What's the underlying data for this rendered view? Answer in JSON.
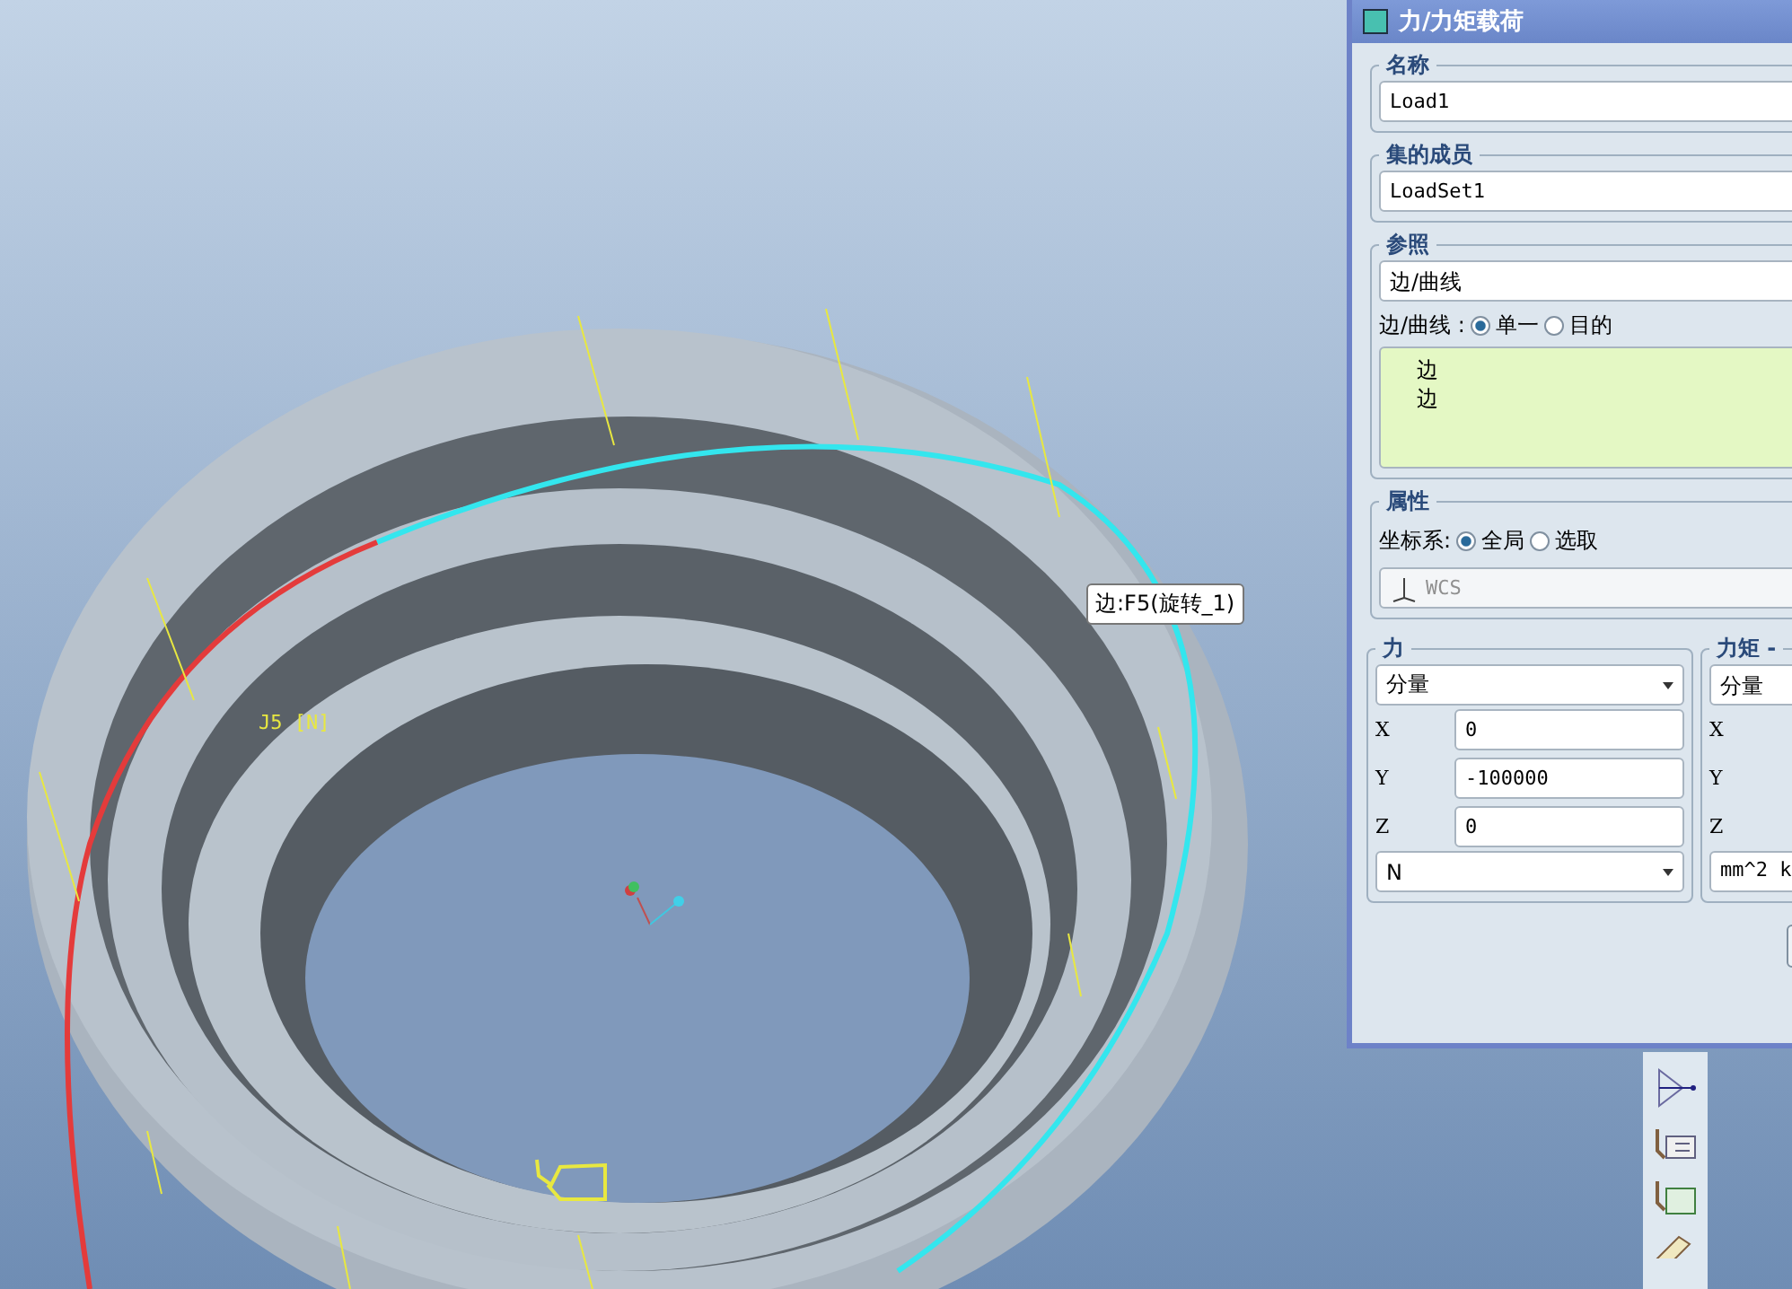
{
  "viewport": {
    "edge_tooltip": "边:F5(旋转_1)",
    "load_label": "J5 [N]"
  },
  "dialog": {
    "title": "力/力矩载荷",
    "name": {
      "label": "名称",
      "value": "Load1"
    },
    "set_member": {
      "label": "集的成员",
      "value": "LoadSet1"
    },
    "reference": {
      "label": "参照",
      "type": "边/曲线",
      "mode_label": "边/曲线 :",
      "modes": [
        {
          "label": "单一",
          "selected": true
        },
        {
          "label": "目的",
          "selected": false
        }
      ],
      "items": [
        "边",
        "边"
      ]
    },
    "properties": {
      "label": "属性",
      "csys_label": "坐标系:",
      "csys_options": [
        {
          "label": "全局",
          "selected": true
        },
        {
          "label": "选取",
          "selected": false
        }
      ],
      "csys": {
        "value": "WCS",
        "disabled": true
      }
    },
    "force": {
      "label": "力",
      "mode": "分量",
      "components": [
        {
          "axis": "X",
          "value": "0"
        },
        {
          "axis": "Y",
          "value": "-100000"
        },
        {
          "axis": "Z",
          "value": "0"
        }
      ],
      "unit": "N"
    },
    "moment": {
      "label": "力矩 -",
      "mode": "分量",
      "axes": [
        "X",
        "Y",
        "Z"
      ],
      "unit": "mm^2 k"
    }
  }
}
